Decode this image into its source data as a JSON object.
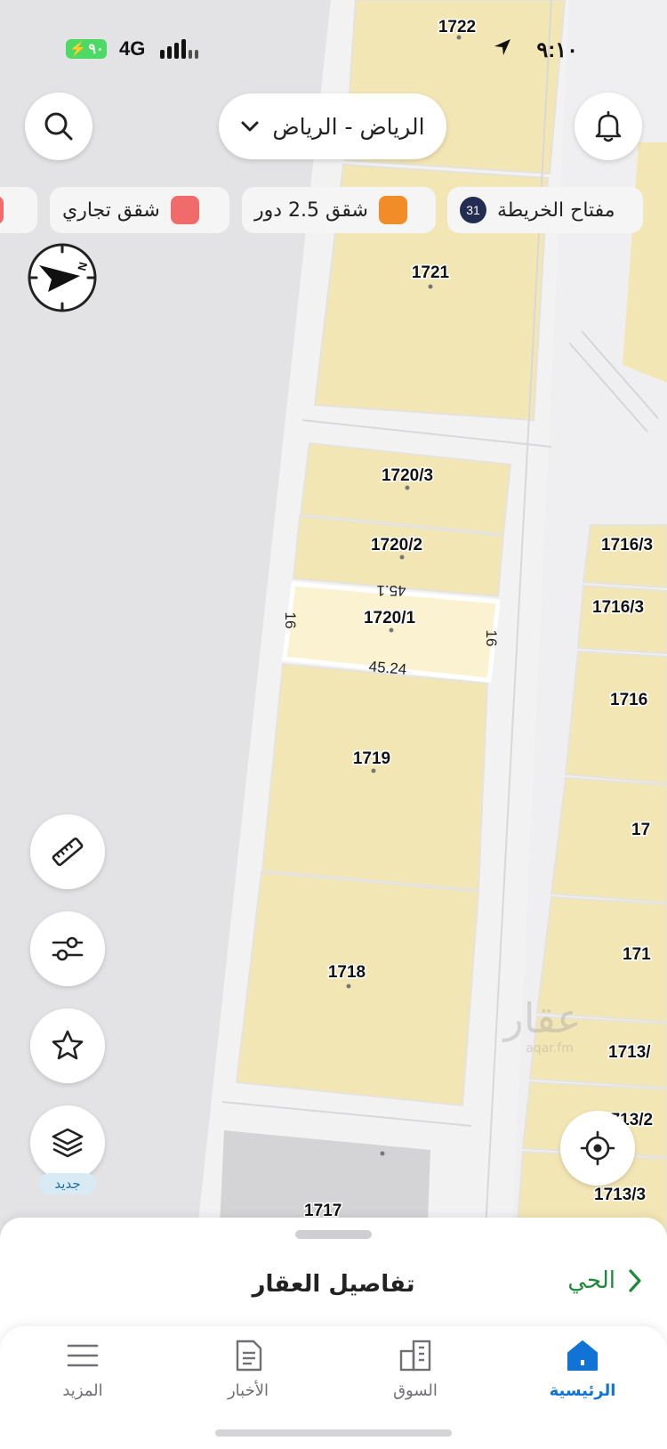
{
  "status_bar": {
    "time": "٩:١٠",
    "network": "4G",
    "battery": "٩٠",
    "signal_icon": "signal-icon",
    "location_icon": "location-arrow-icon"
  },
  "top": {
    "city_selector": "الرياض - الرياض",
    "search_icon": "search-icon",
    "bell_icon": "bell-icon",
    "chevron_icon": "chevron-down-icon"
  },
  "chips": [
    {
      "label": "مفتاح الخريطة",
      "badge": "31"
    },
    {
      "label": "شقق 2.5 دور",
      "color": "#f28c28"
    },
    {
      "label": "شقق تجاري",
      "color": "#f26b6b"
    },
    {
      "label": "",
      "color": "#f26b6b"
    }
  ],
  "map": {
    "parcels": [
      "1722",
      "1721",
      "1720/3",
      "1720/2",
      "1720/1",
      "1719",
      "1718",
      "1716/3",
      "1716/3",
      "1716",
      "17",
      "171",
      "1713/",
      "1713/2",
      "1713/3",
      "1717"
    ],
    "dimensions": {
      "top": "45.1",
      "bottom": "45.24",
      "left": "16",
      "right": "16"
    },
    "watermark": "عقار",
    "watermark_sub": "aqar.fm",
    "parcel_color": "#f3e6b5",
    "selected_color": "#fbf2d2",
    "road_color": "#f2f2f3"
  },
  "tools": {
    "ruler_icon": "ruler-icon",
    "filter_icon": "sliders-icon",
    "star_icon": "star-icon",
    "layers_icon": "layers-icon",
    "new_tag": "جديد",
    "locate_icon": "crosshair-icon",
    "compass_icon": "compass-icon"
  },
  "sheet": {
    "title": "تفاصيل العقار",
    "neighborhood": "الحي"
  },
  "tabbar": {
    "home": "الرئيسية",
    "market": "السوق",
    "news": "الأخبار",
    "more": "المزيد",
    "active_color": "#1273d6"
  }
}
